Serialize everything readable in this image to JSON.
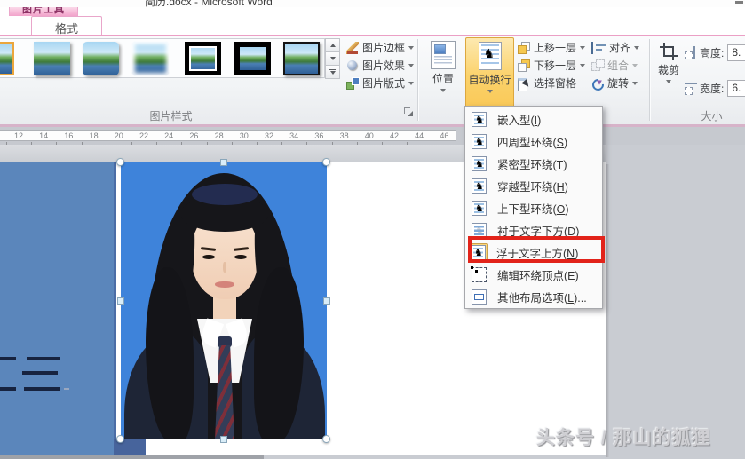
{
  "window": {
    "title": "简历.docx - Microsoft Word",
    "contextual_tab_label": "图片工具",
    "format_tab_label": "格式"
  },
  "ribbon": {
    "picture_styles_group_label": "图片样式",
    "gallery_styles": [
      {
        "name": "style-frame-selected"
      },
      {
        "name": "style-drop-shadow"
      },
      {
        "name": "style-rounded"
      },
      {
        "name": "style-soft-edges"
      },
      {
        "name": "style-black-frame-inset"
      },
      {
        "name": "style-black-frame"
      },
      {
        "name": "style-thin-frame"
      }
    ],
    "style_buttons": [
      {
        "label": "图片边框"
      },
      {
        "label": "图片效果"
      },
      {
        "label": "图片版式"
      }
    ],
    "arrange": {
      "position_label": "位置",
      "wrap_text_label": "自动换行",
      "bring_forward_label": "上移一层",
      "send_backward_label": "下移一层",
      "selection_pane_label": "选择窗格",
      "align_label": "对齐",
      "group_label": "组合",
      "rotate_label": "旋转"
    },
    "size": {
      "group_label": "大小",
      "crop_label": "裁剪",
      "height_label": "高度:",
      "height_value": "8.",
      "width_label": "宽度:",
      "width_value": "6."
    }
  },
  "ruler": {
    "numbers": [
      12,
      14,
      16,
      18,
      20,
      22,
      24,
      26,
      28,
      30,
      32,
      34,
      36,
      38,
      40,
      42,
      44,
      46
    ]
  },
  "wrap_menu": {
    "items": [
      {
        "label": "嵌入型",
        "accel": "I"
      },
      {
        "label": "四周型环绕",
        "accel": "S"
      },
      {
        "label": "紧密型环绕",
        "accel": "T"
      },
      {
        "label": "穿越型环绕",
        "accel": "H"
      },
      {
        "label": "上下型环绕",
        "accel": "O"
      },
      {
        "label": "衬于文字下方",
        "accel": "D"
      },
      {
        "label": "浮于文字上方",
        "accel": "N",
        "highlighted": true,
        "annotated": true
      },
      {
        "label": "编辑环绕顶点",
        "accel": "E"
      },
      {
        "label": "其他布局选项",
        "accel": "L",
        "suffix": "..."
      }
    ]
  },
  "document": {
    "photo_alt": "证件照",
    "watermark": "头条号 / 那山的狐狸"
  },
  "colors": {
    "highlight_orange": "#fbd26b",
    "annotation_red": "#e2231a",
    "panel_blue": "#5b86bb",
    "photo_background_blue": "#3e83da",
    "contextual_tab_pink": "#f2a3ca"
  }
}
